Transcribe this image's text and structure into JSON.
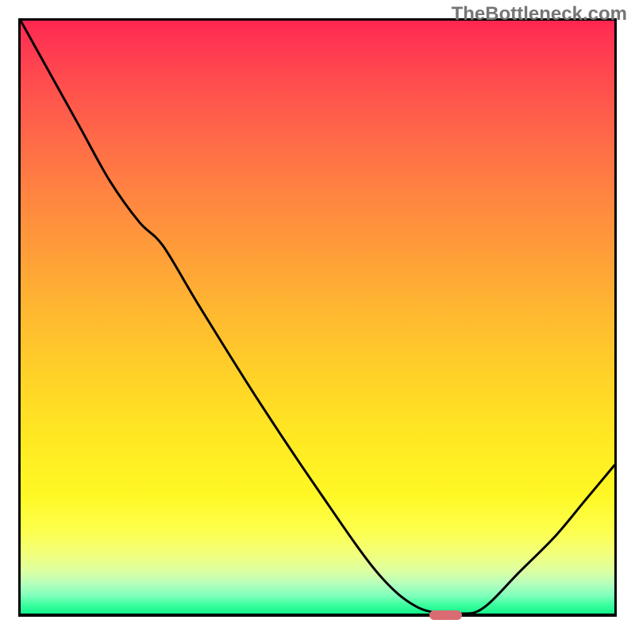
{
  "watermark": "TheBottleneck.com",
  "chart_data": {
    "type": "line",
    "title": "",
    "xlabel": "",
    "ylabel": "",
    "xlim": [
      0,
      100
    ],
    "ylim": [
      0,
      100
    ],
    "grid": false,
    "note": "axes unlabeled; values are percentages of plot extent read from pixel positions",
    "series": [
      {
        "name": "curve",
        "x": [
          0,
          5,
          10,
          15,
          20,
          24,
          30,
          40,
          50,
          60,
          67,
          74,
          78,
          84,
          90,
          95,
          100
        ],
        "y": [
          100,
          91,
          82,
          73,
          66,
          62,
          52,
          36,
          21,
          7,
          1,
          0,
          1,
          7,
          13,
          19,
          25
        ]
      }
    ],
    "marker": {
      "x": 71,
      "y": 0.7,
      "width_pct": 5.5,
      "height_pct": 1.6,
      "color": "#d96b72"
    },
    "gradient_stops": [
      {
        "pct": 0,
        "color": "#ff2550"
      },
      {
        "pct": 50,
        "color": "#ffba30"
      },
      {
        "pct": 86,
        "color": "#fdff4d"
      },
      {
        "pct": 100,
        "color": "#12f28a"
      }
    ]
  }
}
